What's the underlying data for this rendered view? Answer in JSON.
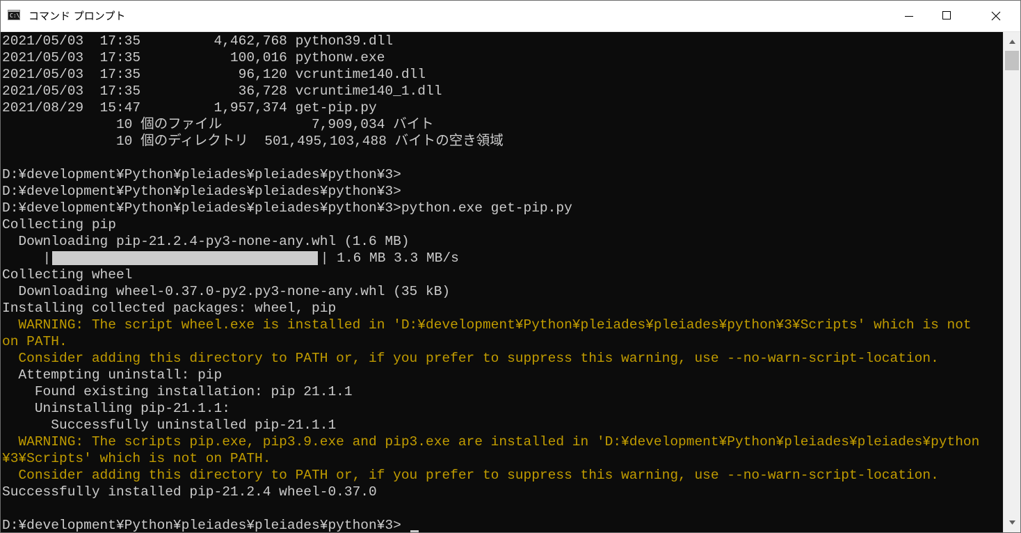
{
  "window": {
    "title": "コマンド プロンプト",
    "app_icon_text": "C:\\."
  },
  "caption_buttons": [
    "minimize",
    "maximize",
    "close"
  ],
  "colors": {
    "background": "#0c0c0c",
    "text": "#cccccc",
    "warning": "#c19c00",
    "progress": "#cccccc"
  },
  "console": {
    "lines": [
      {
        "text": "2021/05/03  17:35         4,462,768 python39.dll",
        "type": "normal"
      },
      {
        "text": "2021/05/03  17:35           100,016 pythonw.exe",
        "type": "normal"
      },
      {
        "text": "2021/05/03  17:35            96,120 vcruntime140.dll",
        "type": "normal"
      },
      {
        "text": "2021/05/03  17:35            36,728 vcruntime140_1.dll",
        "type": "normal"
      },
      {
        "text": "2021/08/29  15:47         1,957,374 get-pip.py",
        "type": "normal"
      },
      {
        "text": "              10 個のファイル           7,909,034 バイト",
        "type": "normal"
      },
      {
        "text": "              10 個のディレクトリ  501,495,103,488 バイトの空き領域",
        "type": "normal"
      },
      {
        "text": "",
        "type": "normal"
      },
      {
        "text": "D:¥development¥Python¥pleiades¥pleiades¥python¥3>",
        "type": "normal"
      },
      {
        "text": "D:¥development¥Python¥pleiades¥pleiades¥python¥3>",
        "type": "normal"
      },
      {
        "text": "D:¥development¥Python¥pleiades¥pleiades¥python¥3>python.exe get-pip.py",
        "type": "normal"
      },
      {
        "text": "Collecting pip",
        "type": "normal"
      },
      {
        "text": "  Downloading pip-21.2.4-py3-none-any.whl (1.6 MB)",
        "type": "normal"
      },
      {
        "text": "     |                                ♦ 1.6 MB 3.3 MB/s",
        "type": "progress"
      },
      {
        "text": "Collecting wheel",
        "type": "normal"
      },
      {
        "text": "  Downloading wheel-0.37.0-py2.py3-none-any.whl (35 kB)",
        "type": "normal"
      },
      {
        "text": "Installing collected packages: wheel, pip",
        "type": "normal"
      },
      {
        "text": "  WARNING: The script wheel.exe is installed in 'D:¥development¥Python¥pleiades¥pleiades¥python¥3¥Scripts' which is not",
        "type": "warning"
      },
      {
        "text": "on PATH.",
        "type": "warning"
      },
      {
        "text": "  Consider adding this directory to PATH or, if you prefer to suppress this warning, use --no-warn-script-location.",
        "type": "warning"
      },
      {
        "text": "  Attempting uninstall: pip",
        "type": "normal"
      },
      {
        "text": "    Found existing installation: pip 21.1.1",
        "type": "normal"
      },
      {
        "text": "    Uninstalling pip-21.1.1:",
        "type": "normal"
      },
      {
        "text": "      Successfully uninstalled pip-21.1.1",
        "type": "normal"
      },
      {
        "text": "  WARNING: The scripts pip.exe, pip3.9.exe and pip3.exe are installed in 'D:¥development¥Python¥pleiades¥pleiades¥python",
        "type": "warning"
      },
      {
        "text": "¥3¥Scripts' which is not on PATH.",
        "type": "warning"
      },
      {
        "text": "  Consider adding this directory to PATH or, if you prefer to suppress this warning, use --no-warn-script-location.",
        "type": "warning"
      },
      {
        "text": "Successfully installed pip-21.2.4 wheel-0.37.0",
        "type": "normal"
      },
      {
        "text": "",
        "type": "normal"
      },
      {
        "text": "D:¥development¥Python¥pleiades¥pleiades¥python¥3>",
        "type": "prompt"
      }
    ],
    "progress": {
      "prefix": "     |",
      "suffix": "| 1.6 MB 3.3 MB/s",
      "fraction": 1.0
    }
  }
}
